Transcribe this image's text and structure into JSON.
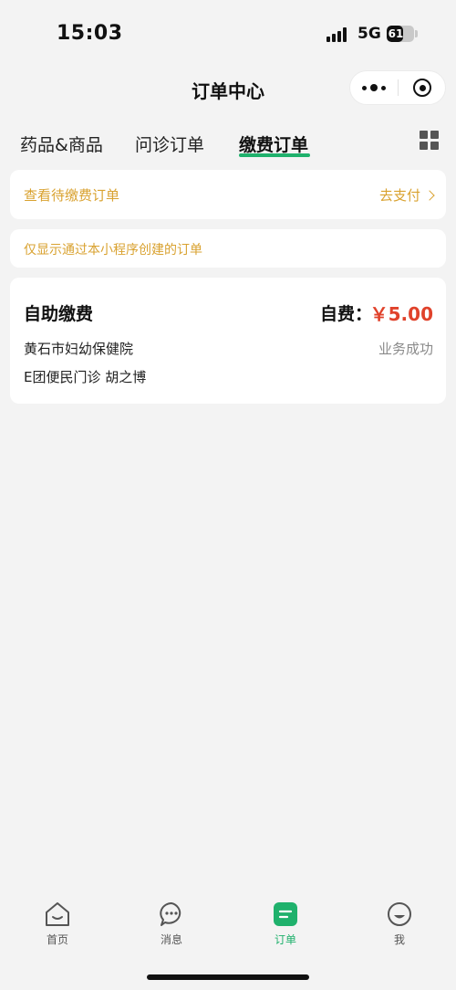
{
  "status_bar": {
    "time": "15:03",
    "network": "5G",
    "battery": "61",
    "battery_level": 0.61
  },
  "nav": {
    "title": "订单中心",
    "more_icon": "more-dots-icon",
    "close_icon": "target-close-icon"
  },
  "tabs": [
    {
      "label": "药品&商品",
      "active": false
    },
    {
      "label": "问诊订单",
      "active": false
    },
    {
      "label": "缴费订单",
      "active": true
    }
  ],
  "grid_icon": "grid-icon",
  "pending": {
    "label": "查看待缴费订单",
    "action": "去支付"
  },
  "notice": {
    "text": "仅显示通过本小程序创建的订单"
  },
  "order": {
    "title": "自助缴费",
    "amount_label": "自费：",
    "amount": "￥5.00",
    "hospital": "黄石市妇幼保健院",
    "status": "业务成功",
    "department": "E团便民门诊 胡之博"
  },
  "tabbar": [
    {
      "label": "首页",
      "icon": "home-icon",
      "active": false
    },
    {
      "label": "消息",
      "icon": "message-icon",
      "active": false
    },
    {
      "label": "订单",
      "icon": "order-icon",
      "active": true
    },
    {
      "label": "我",
      "icon": "profile-icon",
      "active": false
    }
  ],
  "colors": {
    "accent": "#1fb16c",
    "warning": "#d9a230",
    "price": "#e0422b",
    "background": "#f3f3f3"
  }
}
